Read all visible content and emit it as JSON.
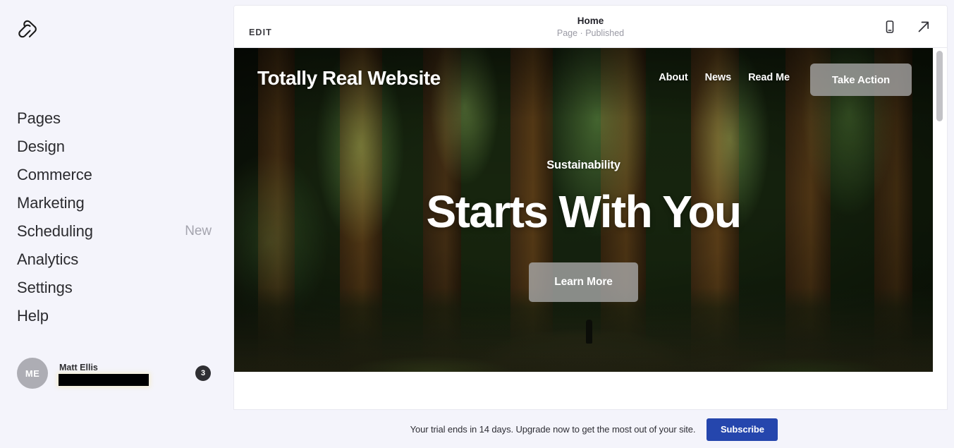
{
  "sidebar": {
    "logo_icon": "squarespace-logo-icon",
    "items": [
      {
        "label": "Pages",
        "badge": ""
      },
      {
        "label": "Design",
        "badge": ""
      },
      {
        "label": "Commerce",
        "badge": ""
      },
      {
        "label": "Marketing",
        "badge": ""
      },
      {
        "label": "Scheduling",
        "badge": "New"
      },
      {
        "label": "Analytics",
        "badge": ""
      },
      {
        "label": "Settings",
        "badge": ""
      },
      {
        "label": "Help",
        "badge": ""
      }
    ],
    "user": {
      "initials": "ME",
      "name": "Matt Ellis",
      "email_redacted": true,
      "notification_count": "3"
    }
  },
  "topbar": {
    "edit_label": "EDIT",
    "page_title": "Home",
    "page_status": "Page · Published",
    "mobile_icon": "mobile-device-icon",
    "external_icon": "open-in-new-arrow-icon"
  },
  "site_preview": {
    "logo_text": "Totally Real Website",
    "nav_links": [
      "About",
      "News",
      "Read Me"
    ],
    "header_cta": "Take Action",
    "hero": {
      "eyebrow": "Sustainability",
      "heading": "Starts With You",
      "cta": "Learn More"
    },
    "clipped_next_section": "­ ­ ­ ­ ­ ­"
  },
  "trial_banner": {
    "message": "Your trial ends in 14 days. Upgrade now to get the most out of your site.",
    "button_label": "Subscribe"
  },
  "colors": {
    "sidebar_bg": "#f4f4fb",
    "accent_blue": "#2546ad",
    "text_dark": "#2b2b2f",
    "text_muted": "#9a9aa4",
    "badge_dark": "#2f2f33"
  }
}
